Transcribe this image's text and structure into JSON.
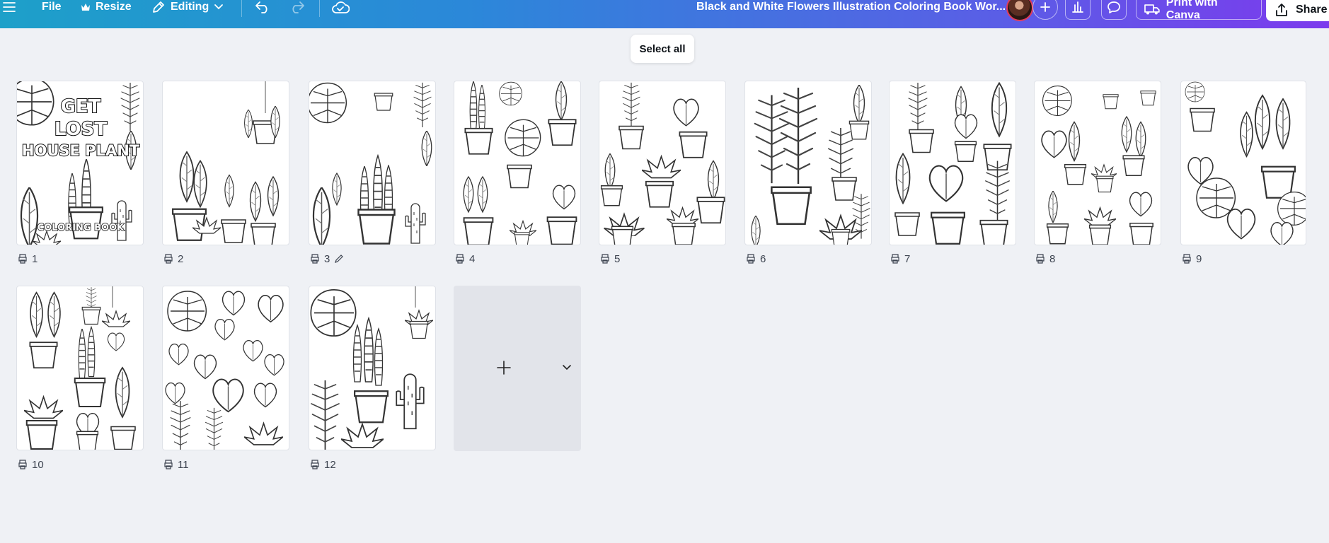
{
  "topbar": {
    "file_label": "File",
    "resize_label": "Resize",
    "editing_label": "Editing",
    "document_title": "Black and White Flowers Illustration Coloring Book Wor...",
    "print_label": "Print with Canva",
    "share_label": "Share"
  },
  "grid": {
    "select_all_label": "Select all",
    "pages": [
      {
        "number": "1",
        "cover_line1": "GET",
        "cover_line2": "LOST",
        "cover_line3": "HOUSE PLANT",
        "cover_sub": "COLORING BOOK"
      },
      {
        "number": "2"
      },
      {
        "number": "3"
      },
      {
        "number": "4"
      },
      {
        "number": "5"
      },
      {
        "number": "6"
      },
      {
        "number": "7"
      },
      {
        "number": "8"
      },
      {
        "number": "9"
      },
      {
        "number": "10"
      },
      {
        "number": "11"
      },
      {
        "number": "12"
      }
    ]
  },
  "icons": {
    "menu": "hamburger-menu-icon",
    "resize": "crown-icon",
    "editing": "pencil-icon",
    "undo": "undo-icon",
    "redo": "redo-icon",
    "save": "cloud-check-icon",
    "add_people": "plus-icon",
    "insights": "bar-chart-icon",
    "comments": "comment-icon",
    "print": "truck-icon",
    "share": "upload-icon",
    "page_print": "printer-icon",
    "page_edit": "pencil-icon",
    "add_page": "plus-icon",
    "add_page_more": "chevron-down-icon"
  },
  "colors": {
    "canvas_bg": "#eff1f5",
    "topbar_start": "#1da0c9",
    "topbar_end": "#7c3aed"
  }
}
